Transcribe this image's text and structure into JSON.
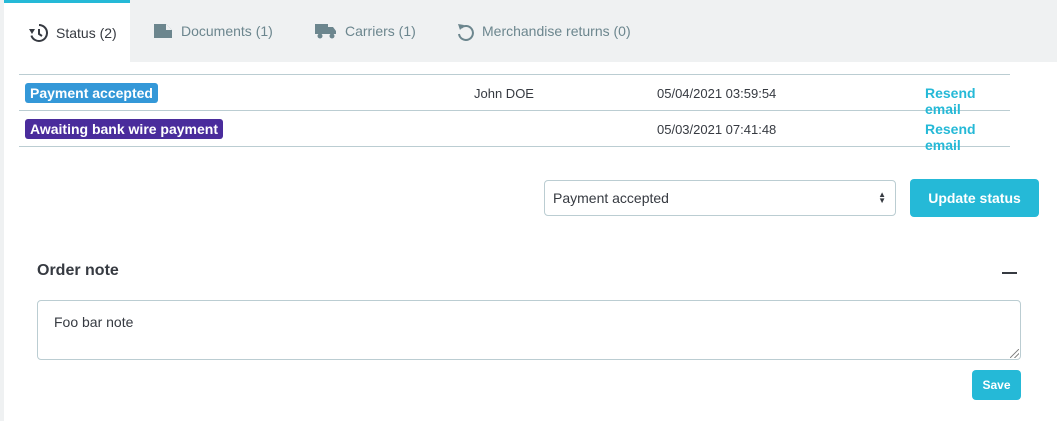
{
  "tabs": [
    {
      "label": "Status (2)",
      "icon": "history-icon",
      "active": true
    },
    {
      "label": "Documents (1)",
      "icon": "folder-icon",
      "active": false
    },
    {
      "label": "Carriers (1)",
      "icon": "truck-icon",
      "active": false
    },
    {
      "label": "Merchandise returns (0)",
      "icon": "undo-icon",
      "active": false
    }
  ],
  "history": [
    {
      "status": "Payment accepted",
      "status_color": "#3498d8",
      "employee": "John DOE",
      "date": "05/04/2021 03:59:54",
      "action": "Resend email"
    },
    {
      "status": "Awaiting bank wire payment",
      "status_color": "#4169e1",
      "employee": "",
      "date": "05/03/2021 07:41:48",
      "action": "Resend email"
    }
  ],
  "status_select": {
    "value": "Payment accepted"
  },
  "update_button": "Update status",
  "order_note": {
    "title": "Order note",
    "value": "Foo bar note",
    "save_label": "Save"
  },
  "colors": {
    "accent": "#25b9d7",
    "text": "#363a41",
    "muted": "#6c868e"
  }
}
